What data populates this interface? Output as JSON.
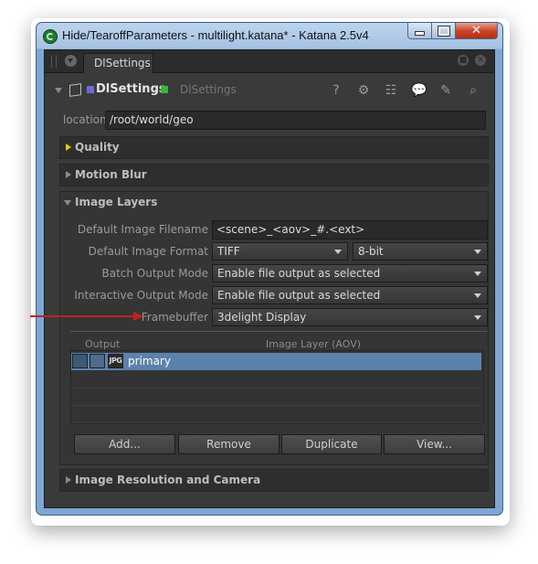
{
  "window": {
    "title": "Hide/TearoffParameters - multilight.katana* - Katana 2.5v4",
    "minimize": "",
    "maximize": "",
    "close": "✕"
  },
  "tab": {
    "label": "DlSettings"
  },
  "node": {
    "name": "DlSettings",
    "type": "DlSettings",
    "name_color": "#6b6bd6",
    "state_color": "#3bb53b"
  },
  "location": {
    "label": "location",
    "value": "/root/world/geo"
  },
  "groups": {
    "quality": "Quality",
    "motion_blur": "Motion Blur",
    "image_layers": "Image Layers",
    "image_resolution": "Image Resolution and Camera"
  },
  "params": {
    "default_filename": {
      "label": "Default Image Filename",
      "value": "<scene>_<aov>_#.<ext>"
    },
    "default_format": {
      "label": "Default Image Format",
      "value": "TIFF",
      "bitdepth": "8-bit"
    },
    "batch_output": {
      "label": "Batch Output Mode",
      "value": "Enable file output as selected"
    },
    "interactive_output": {
      "label": "Interactive Output Mode",
      "value": "Enable file output as selected"
    },
    "framebuffer": {
      "label": "Framebuffer",
      "value": "3delight Display"
    }
  },
  "table": {
    "col_output": "Output",
    "col_layer": "Image Layer (AOV)",
    "rows": [
      {
        "jpg": "JPG",
        "layer": "primary"
      }
    ]
  },
  "buttons": {
    "add": "Add...",
    "remove": "Remove",
    "duplicate": "Duplicate",
    "view": "View..."
  },
  "icons": {
    "help": "help-icon",
    "settings": "gear-icon",
    "graph": "graph-icon",
    "comment": "comment-icon",
    "wrench": "wrench-icon",
    "search": "search-icon"
  },
  "colors": {
    "annotation_arrow": "#c0211e",
    "quality_marker": "#f2c200",
    "selection": "#5b82ac"
  }
}
